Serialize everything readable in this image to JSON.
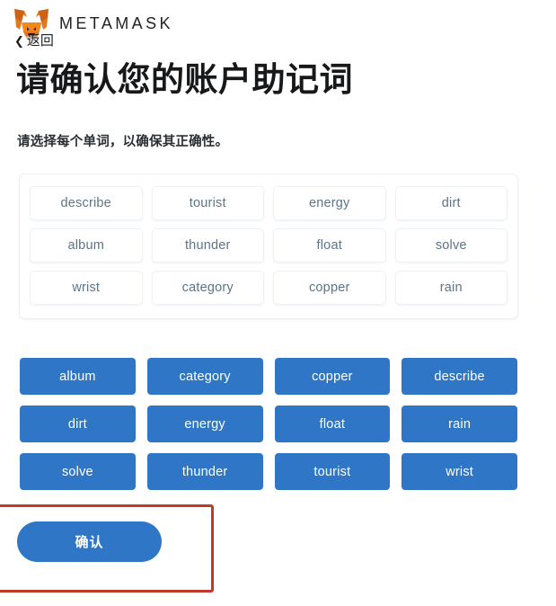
{
  "brand": {
    "logo_icon": "metamask-fox-icon",
    "wordmark": "METAMASK"
  },
  "nav": {
    "back_label": "返回",
    "back_icon": "chevron-left-icon"
  },
  "page": {
    "title": "请确认您的账户助记词",
    "subtitle": "请选择每个单词，以确保其正确性。"
  },
  "selected_words": [
    "describe",
    "tourist",
    "energy",
    "dirt",
    "album",
    "thunder",
    "float",
    "solve",
    "wrist",
    "category",
    "copper",
    "rain"
  ],
  "word_bank": [
    "album",
    "category",
    "copper",
    "describe",
    "dirt",
    "energy",
    "float",
    "rain",
    "solve",
    "thunder",
    "tourist",
    "wrist"
  ],
  "actions": {
    "confirm_label": "确认"
  },
  "colors": {
    "accent_blue": "#2f76c6",
    "annotation_red": "#c0392b",
    "word_card_text": "#5c7488",
    "title_text": "#16181a"
  }
}
